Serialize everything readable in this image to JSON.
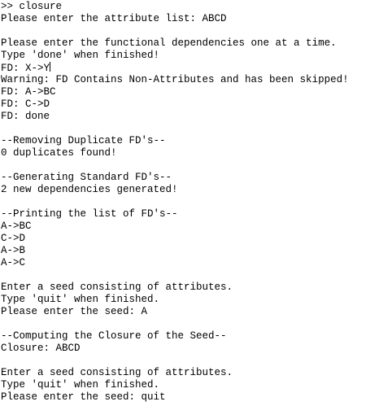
{
  "terminal": {
    "lines": [
      {
        "text": ">> closure"
      },
      {
        "text": "Please enter the attribute list: ABCD"
      },
      {
        "text": ""
      },
      {
        "text": "Please enter the functional dependencies one at a time."
      },
      {
        "text": "Type 'done' when finished!"
      },
      {
        "text": "FD: X->Y",
        "caret": true
      },
      {
        "text": "Warning: FD Contains Non-Attributes and has been skipped!"
      },
      {
        "text": "FD: A->BC"
      },
      {
        "text": "FD: C->D"
      },
      {
        "text": "FD: done"
      },
      {
        "text": ""
      },
      {
        "text": "--Removing Duplicate FD's--"
      },
      {
        "text": "0 duplicates found!"
      },
      {
        "text": ""
      },
      {
        "text": "--Generating Standard FD's--"
      },
      {
        "text": "2 new dependencies generated!"
      },
      {
        "text": ""
      },
      {
        "text": "--Printing the list of FD's--"
      },
      {
        "text": "A->BC"
      },
      {
        "text": "C->D"
      },
      {
        "text": "A->B"
      },
      {
        "text": "A->C"
      },
      {
        "text": ""
      },
      {
        "text": "Enter a seed consisting of attributes."
      },
      {
        "text": "Type 'quit' when finished."
      },
      {
        "text": "Please enter the seed: A"
      },
      {
        "text": ""
      },
      {
        "text": "--Computing the Closure of the Seed--"
      },
      {
        "text": "Closure: ABCD"
      },
      {
        "text": ""
      },
      {
        "text": "Enter a seed consisting of attributes."
      },
      {
        "text": "Type 'quit' when finished."
      },
      {
        "text": "Please enter the seed: quit"
      }
    ]
  }
}
